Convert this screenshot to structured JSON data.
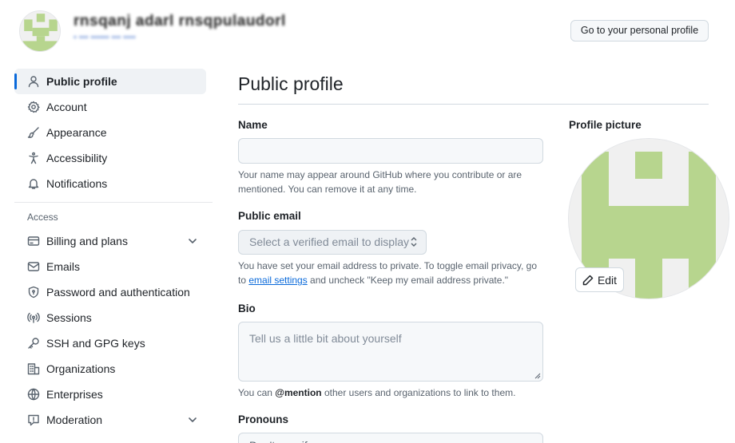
{
  "header": {
    "username_blurred": "rnsqanj adarl rnsqpulaudorl",
    "subtext_blurred": "• ••• •••••• ••• ••••",
    "profile_button": "Go to your personal profile"
  },
  "sidebar": {
    "items": [
      {
        "label": "Public profile",
        "icon": "person-icon",
        "active": true
      },
      {
        "label": "Account",
        "icon": "gear-icon"
      },
      {
        "label": "Appearance",
        "icon": "paintbrush-icon"
      },
      {
        "label": "Accessibility",
        "icon": "accessibility-icon"
      },
      {
        "label": "Notifications",
        "icon": "bell-icon"
      }
    ],
    "access_heading": "Access",
    "access_items": [
      {
        "label": "Billing and plans",
        "icon": "credit-card-icon",
        "expandable": true
      },
      {
        "label": "Emails",
        "icon": "mail-icon"
      },
      {
        "label": "Password and authentication",
        "icon": "shield-lock-icon"
      },
      {
        "label": "Sessions",
        "icon": "broadcast-icon"
      },
      {
        "label": "SSH and GPG keys",
        "icon": "key-icon"
      },
      {
        "label": "Organizations",
        "icon": "organization-icon"
      },
      {
        "label": "Enterprises",
        "icon": "globe-icon"
      },
      {
        "label": "Moderation",
        "icon": "report-icon",
        "expandable": true
      }
    ]
  },
  "main": {
    "title": "Public profile",
    "name": {
      "label": "Name",
      "value": "",
      "note": "Your name may appear around GitHub where you contribute or are mentioned. You can remove it at any time."
    },
    "email": {
      "label": "Public email",
      "placeholder": "Select a verified email to display",
      "note_before": "You have set your email address to private. To toggle email privacy, go to ",
      "note_link": "email settings",
      "note_after": " and uncheck \"Keep my email address private.\""
    },
    "bio": {
      "label": "Bio",
      "placeholder": "Tell us a little bit about yourself",
      "note_before": "You can ",
      "note_mention": "@mention",
      "note_after": " other users and organizations to link to them."
    },
    "pronouns": {
      "label": "Pronouns",
      "value": "Don't specify"
    }
  },
  "profile_picture": {
    "label": "Profile picture",
    "edit_label": "Edit"
  },
  "colors": {
    "accent": "#0969da",
    "identicon": "#b7d58e"
  }
}
